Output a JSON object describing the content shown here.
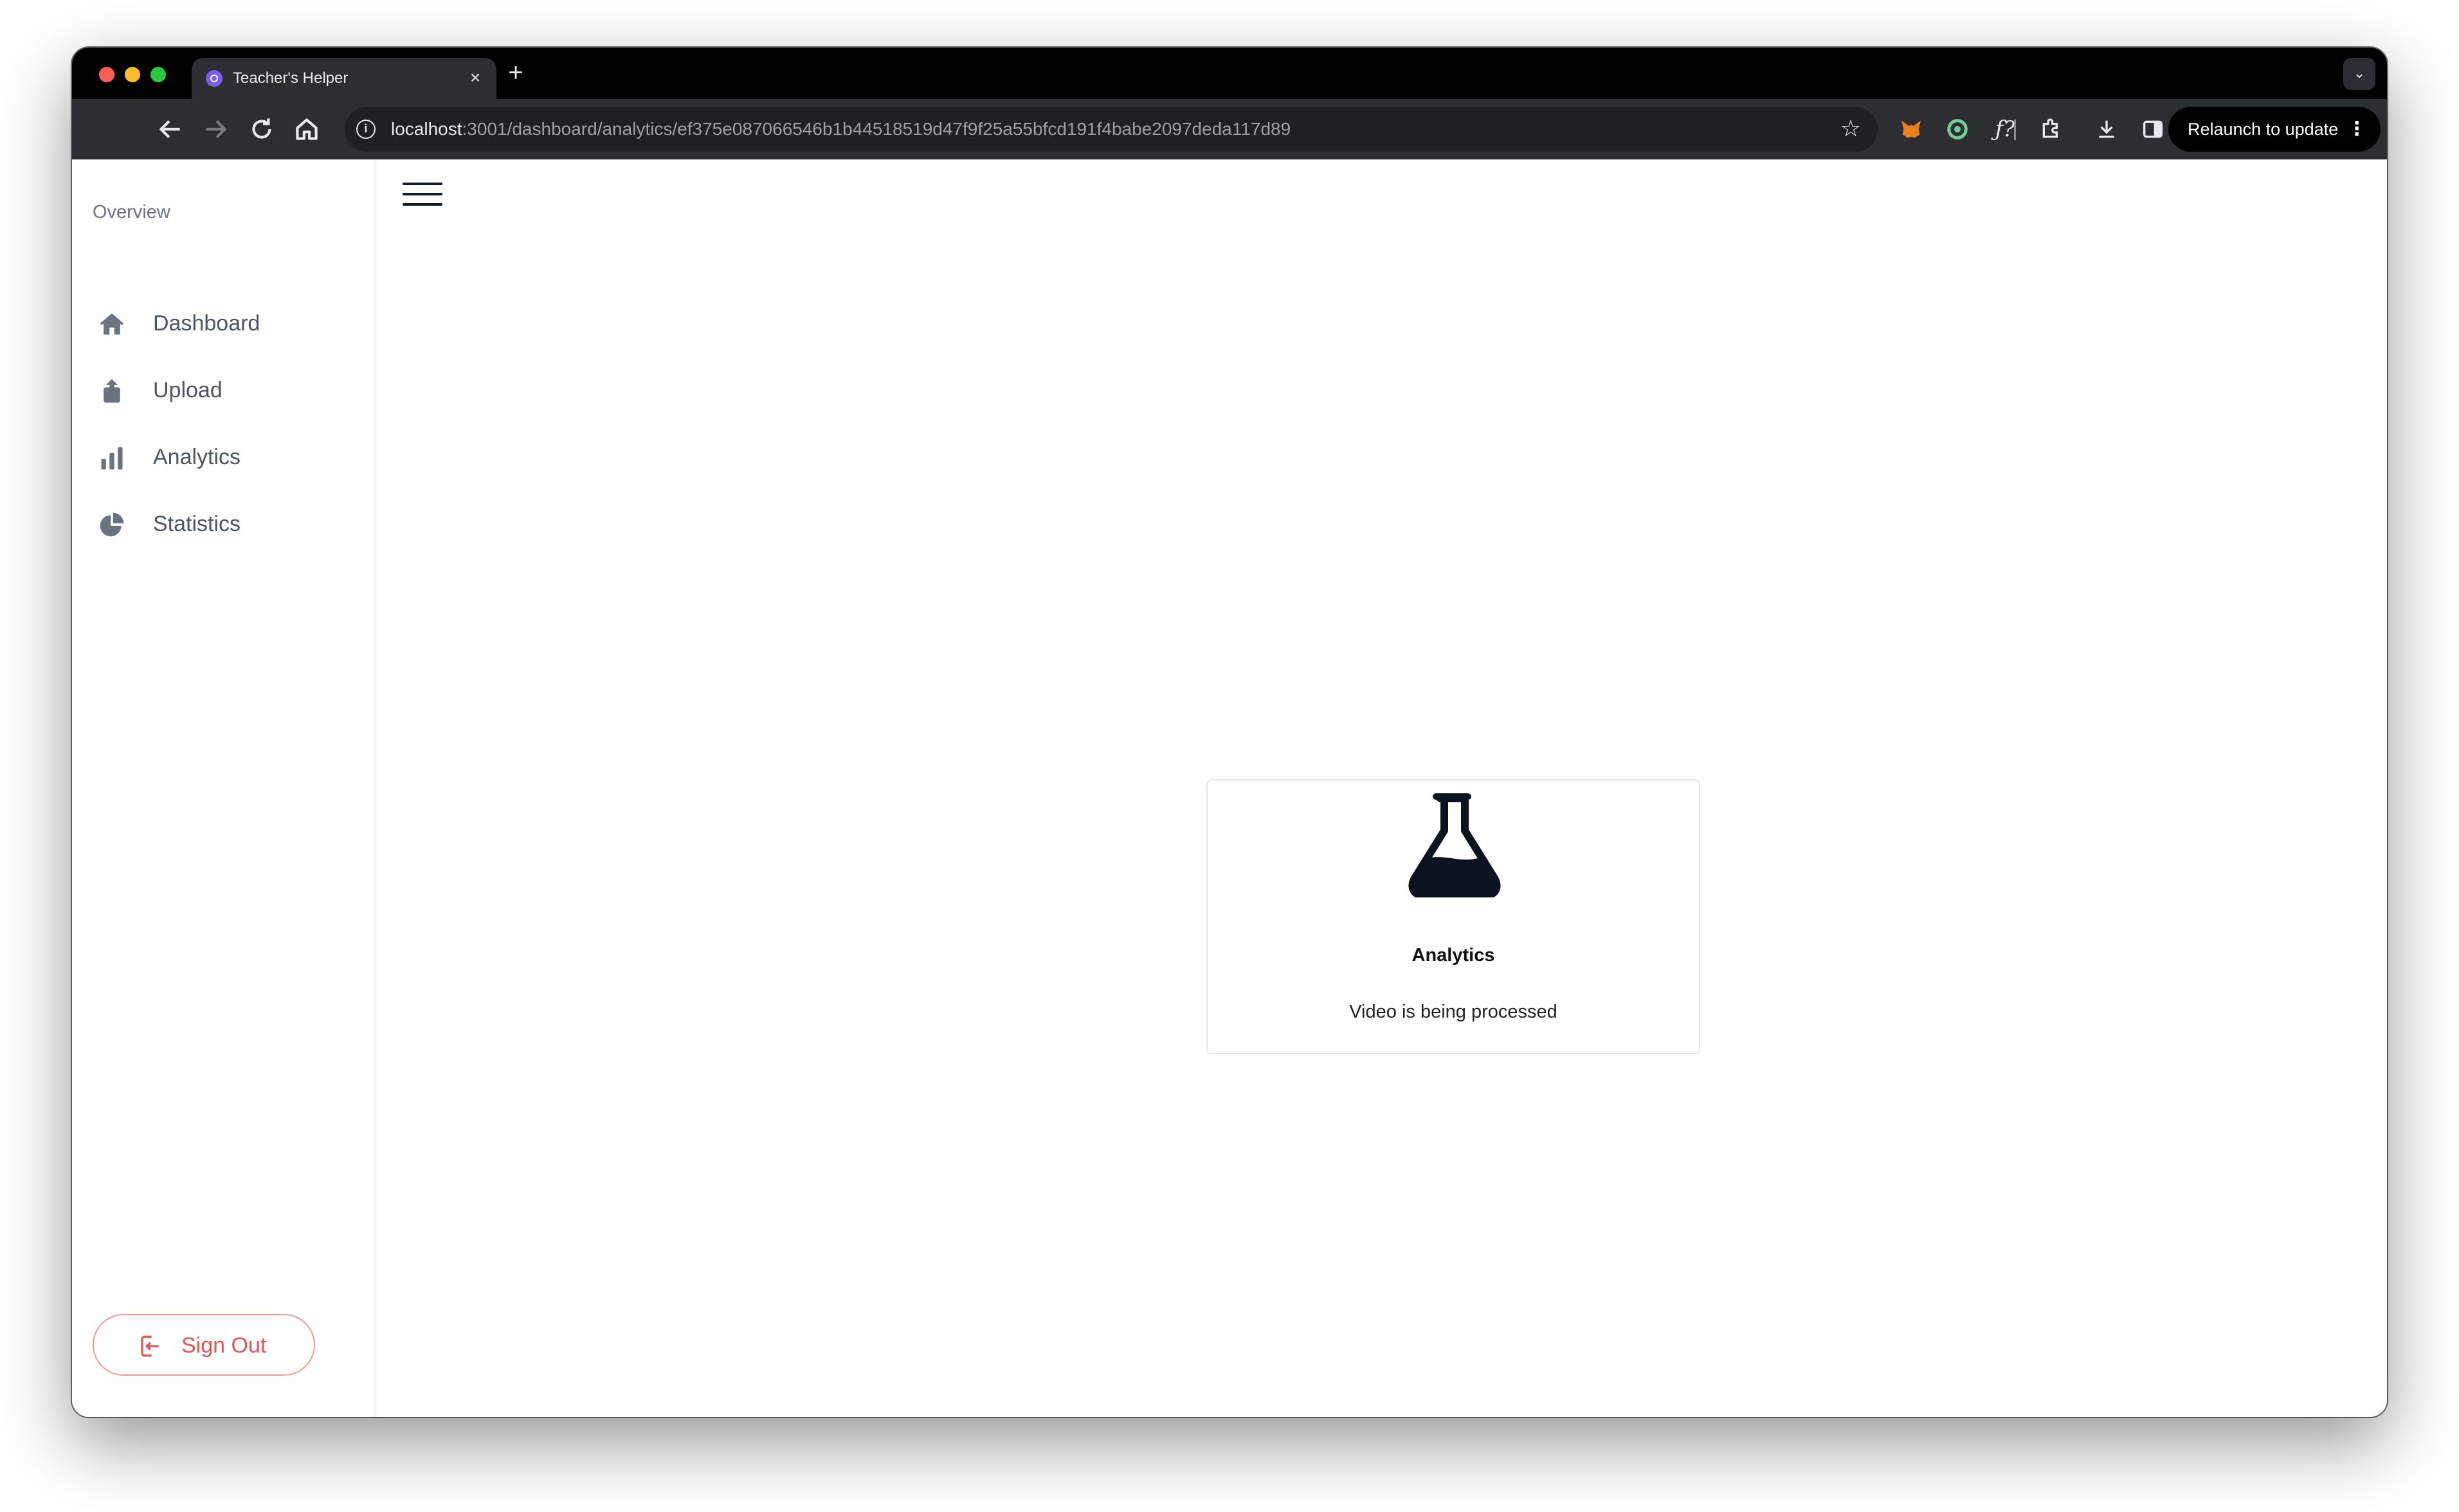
{
  "browser": {
    "tab_title": "Teacher's Helper",
    "tab_close": "×",
    "new_tab": "+",
    "tab_menu": "⌄",
    "url_host": "localhost",
    "url_path": ":3001/dashboard/analytics/ef375e087066546b1b44518519d47f9f25a55bfcd191f4babe2097deda117d89",
    "relaunch_label": "Relaunch to update",
    "relaunch_menu": "⋮",
    "icons": [
      "back-icon",
      "forward-icon",
      "reload-icon",
      "home-icon",
      "site-info-icon",
      "bookmark-star-icon",
      "metamask-extension-icon",
      "ring-extension-icon",
      "function-extension-icon",
      "extensions-puzzle-icon",
      "download-icon",
      "side-panel-icon",
      "profile-avatar"
    ]
  },
  "sidebar": {
    "heading": "Overview",
    "items": [
      {
        "label": "Dashboard",
        "icon": "home-icon"
      },
      {
        "label": "Upload",
        "icon": "upload-icon"
      },
      {
        "label": "Analytics",
        "icon": "bar-chart-icon"
      },
      {
        "label": "Statistics",
        "icon": "pie-chart-icon"
      }
    ],
    "signout_label": "Sign Out"
  },
  "main": {
    "card_title": "Analytics",
    "card_text": "Video is being processed",
    "card_icon": "flask-icon"
  },
  "colors": {
    "signout_accent": "#e25555",
    "nav_text": "#4b5563",
    "chrome_dark": "#2d2e31"
  }
}
